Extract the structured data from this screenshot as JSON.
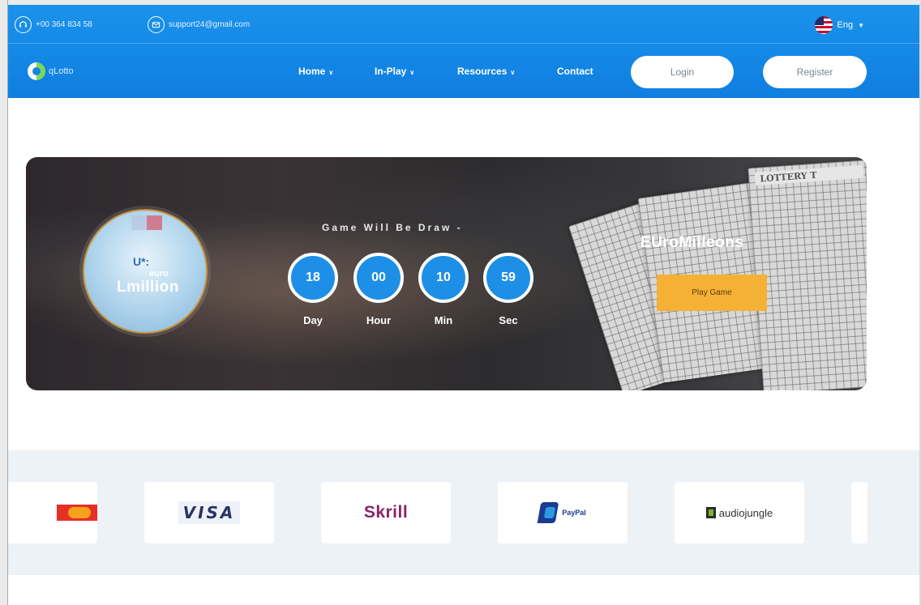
{
  "header": {
    "phone": "+00 364 834 58",
    "email": "support24@gmail.com",
    "language": "Eng",
    "logo_text": "qLotto",
    "nav": {
      "home": "Home",
      "inplay": "In-Play",
      "resources": "Resources",
      "contact": "Contact"
    },
    "login_label": "Login",
    "register_label": "Register"
  },
  "banner": {
    "emblem": {
      "line1": "U*:",
      "line2": "euro",
      "line3": "Lmillion"
    },
    "draw_title": "Game Will Be Draw -",
    "countdown": [
      {
        "value": "18",
        "label": "Day"
      },
      {
        "value": "00",
        "label": "Hour"
      },
      {
        "value": "10",
        "label": "Min"
      },
      {
        "value": "59",
        "label": "Sec"
      }
    ],
    "game_name": "EUroMilleons",
    "play_label": "Play Game",
    "ticket_title": "LOTTERY T"
  },
  "payments": {
    "visa": "VISA",
    "skrill": "Skrill",
    "paypal": "PayPal",
    "audiojungle": "audiojungle"
  }
}
